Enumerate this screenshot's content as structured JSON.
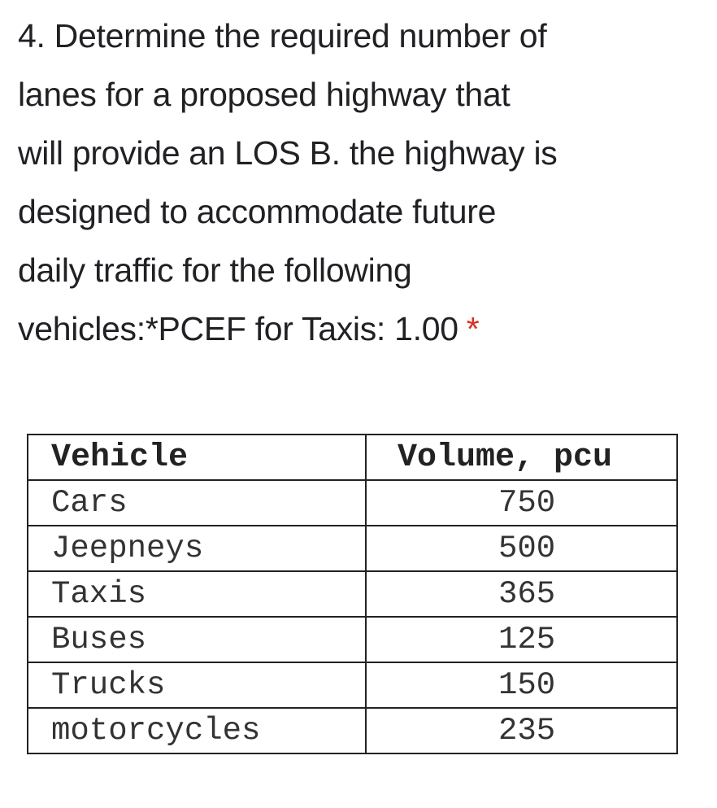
{
  "question": {
    "lines": [
      "4. Determine the required number of",
      "lanes for a proposed highway that",
      "will provide an LOS B. the highway is",
      "designed to accommodate future",
      "daily traffic for the following",
      "vehicles:*PCEF for Taxis: 1.00"
    ],
    "required_marker": "*",
    "required_color": "#d93025"
  },
  "table": {
    "headers": [
      "Vehicle",
      "Volume, pcu"
    ],
    "rows": [
      {
        "vehicle": "Cars",
        "volume": "750"
      },
      {
        "vehicle": "Jeepneys",
        "volume": "500"
      },
      {
        "vehicle": "Taxis",
        "volume": "365"
      },
      {
        "vehicle": "Buses",
        "volume": "125"
      },
      {
        "vehicle": "Trucks",
        "volume": "150"
      },
      {
        "vehicle": "motorcycles",
        "volume": "235"
      }
    ]
  }
}
